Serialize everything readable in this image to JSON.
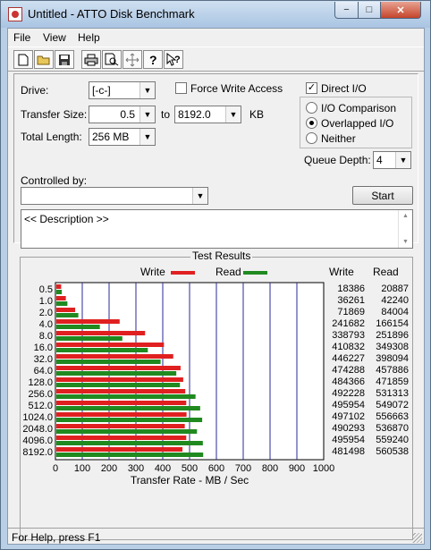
{
  "window": {
    "title": "Untitled - ATTO Disk Benchmark",
    "minimize": "−",
    "maximize": "□",
    "close": "✕"
  },
  "menu": [
    "File",
    "View",
    "Help"
  ],
  "toolbar_icons": [
    "new-icon",
    "open-icon",
    "save-icon",
    "print-icon",
    "print-preview-icon",
    "move-icon",
    "help-icon",
    "context-help-icon"
  ],
  "form": {
    "drive_label": "Drive:",
    "drive_value": "[-c-]",
    "force_write_label": "Force Write Access",
    "force_write_checked": false,
    "direct_io_label": "Direct I/O",
    "direct_io_checked": true,
    "transfer_size_label": "Transfer Size:",
    "transfer_min": "0.5",
    "to_label": "to",
    "transfer_max": "8192.0",
    "kb_label": "KB",
    "total_length_label": "Total Length:",
    "total_length_value": "256 MB",
    "io_options": [
      "I/O Comparison",
      "Overlapped I/O",
      "Neither"
    ],
    "io_selected": 1,
    "queue_depth_label": "Queue Depth:",
    "queue_depth_value": "4",
    "controlled_by_label": "Controlled by:",
    "controlled_by_value": "",
    "start_label": "Start",
    "description": "<< Description >>"
  },
  "results": {
    "title": "Test Results",
    "write_legend": "Write",
    "read_legend": "Read",
    "write_col": "Write",
    "read_col": "Read",
    "write_color": "#e02020",
    "read_color": "#208a20"
  },
  "chart_data": {
    "type": "bar",
    "orientation": "horizontal",
    "categories": [
      "0.5",
      "1.0",
      "2.0",
      "4.0",
      "8.0",
      "16.0",
      "32.0",
      "64.0",
      "128.0",
      "256.0",
      "512.0",
      "1024.0",
      "2048.0",
      "4096.0",
      "8192.0"
    ],
    "series": [
      {
        "name": "Write",
        "values": [
          18386,
          36261,
          71869,
          241682,
          338793,
          410832,
          446227,
          474288,
          484366,
          492228,
          495954,
          497102,
          490293,
          495954,
          481498
        ]
      },
      {
        "name": "Read",
        "values": [
          20887,
          42240,
          84004,
          166154,
          251896,
          349308,
          398094,
          457886,
          471859,
          531313,
          549072,
          556663,
          536870,
          559240,
          560538
        ]
      }
    ],
    "bar_scale_note": "bars in MB/s = value / 1024",
    "xlabel": "Transfer Rate - MB / Sec",
    "xticks": [
      "0",
      "100",
      "200",
      "300",
      "400",
      "500",
      "600",
      "700",
      "800",
      "900",
      "1000"
    ],
    "xlim": [
      0,
      1000
    ],
    "grid": true,
    "legend": "top"
  },
  "status": "For Help, press F1"
}
